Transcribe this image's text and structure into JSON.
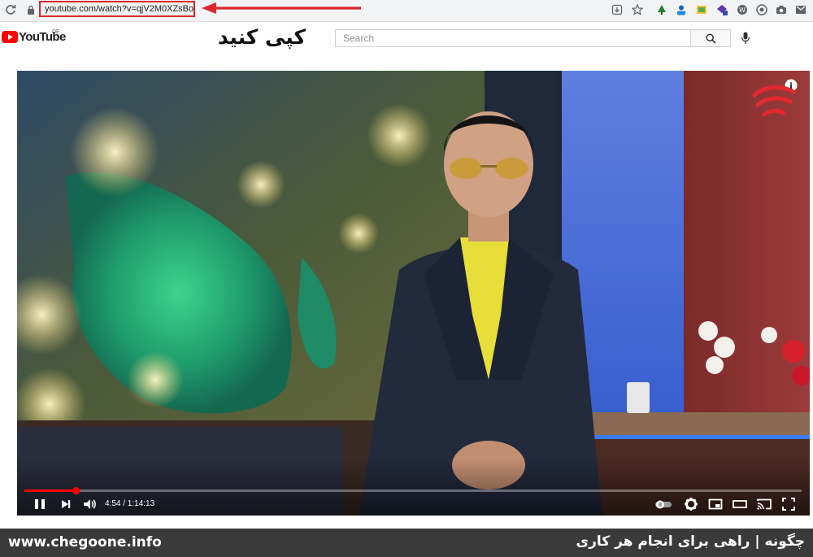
{
  "browser": {
    "url": "youtube.com/watch?v=qjV2M0XZsBo",
    "extension_icons": [
      "download-icon",
      "bookmark-star-icon",
      "extension-tree-icon",
      "extension-person-icon",
      "extension-image-icon",
      "extension-puzzle-icon",
      "wordpress-icon",
      "extension-circle-icon",
      "camera-icon",
      "gmail-icon"
    ]
  },
  "annotation": {
    "instruction": "کپی کنید",
    "arrow_color": "#d9272e"
  },
  "youtube": {
    "logo_text": "YouTube",
    "country_code": "DE",
    "search_placeholder": "Search",
    "brand_color": "#ff0000"
  },
  "player": {
    "time_display": "4:54 / 1:14:13",
    "progress_fraction": 0.066,
    "controls": [
      "pause-icon",
      "next-icon",
      "volume-icon",
      "autoplay-toggle",
      "settings-gear-icon",
      "miniplayer-icon",
      "theater-mode-icon",
      "cast-icon",
      "fullscreen-icon"
    ]
  },
  "footer": {
    "site_url": "www.chegoone.info",
    "tagline": "چگونه | راهی برای انجام هر کاری"
  }
}
